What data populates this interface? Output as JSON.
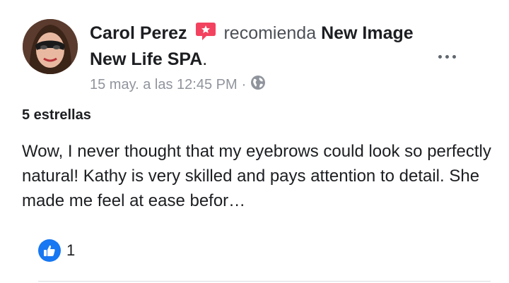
{
  "post": {
    "author": "Carol Perez",
    "action": "recomienda",
    "page_name": "New Image New Life SPA",
    "punctuation": ".",
    "timestamp": "15 may. a las 12:45 PM",
    "separator": "·",
    "privacy_icon": "globe-icon",
    "rating": "5 estrellas",
    "text": "Wow, I never thought that my eyebrows could look so perfectly natural! Kathy is very skilled and pays attention to detail. She made me feel at ease befor…",
    "reaction_count": "1"
  },
  "colors": {
    "recommend_badge": "#f3425f",
    "like_blue": "#1877f2",
    "meta_gray": "#90949c"
  }
}
